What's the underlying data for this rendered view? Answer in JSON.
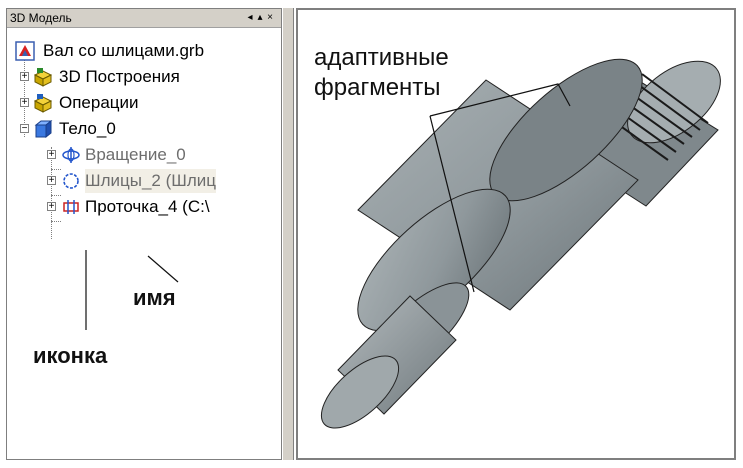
{
  "panel": {
    "title": "3D Модель",
    "buttons": [
      "◂",
      "▴",
      "×"
    ]
  },
  "tree": {
    "root": "Вал со шлицами.grb",
    "items": [
      {
        "label": "3D Построения"
      },
      {
        "label": "Операции"
      },
      {
        "label": "Тело_0"
      },
      {
        "label": "Вращение_0"
      },
      {
        "label": "Шлицы_2 (Шлиц"
      },
      {
        "label": "Проточка_4 (С:\\"
      }
    ]
  },
  "annotations": {
    "icon": "иконка",
    "name": "имя",
    "adaptive_line1": "адаптивные",
    "adaptive_line2": "фрагменты"
  },
  "colors": {
    "panel_bg": "#d4d0c8",
    "part_body": "#9aa3a6",
    "part_dark": "#6b7478",
    "part_light": "#c3cacc"
  }
}
